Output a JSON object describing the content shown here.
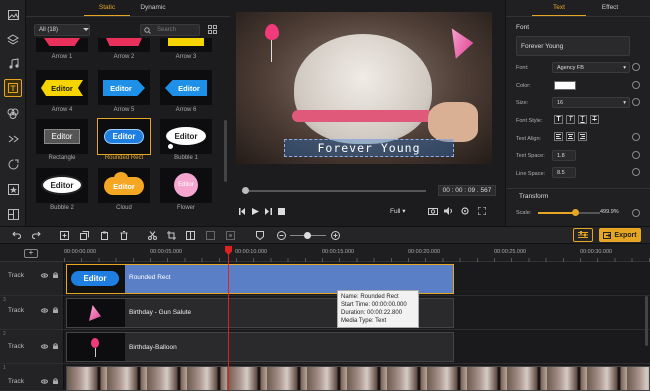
{
  "sidebar": {
    "icons": [
      "film-icon",
      "layers-icon",
      "music-icon",
      "text-icon",
      "transition-icon",
      "effect-icon",
      "sticker-icon",
      "filter-icon",
      "split-icon"
    ]
  },
  "library": {
    "tabs": [
      {
        "label": "Static",
        "active": true
      },
      {
        "label": "Dynamic",
        "active": false
      }
    ],
    "filter_value": "All (18)",
    "search_placeholder": "Search",
    "items": [
      {
        "label": "Arrow 1",
        "text": "Editor"
      },
      {
        "label": "Arrow 2",
        "text": "Editor"
      },
      {
        "label": "Arrow 3",
        "text": "Editor"
      },
      {
        "label": "Arrow 4",
        "text": "Editor"
      },
      {
        "label": "Arrow 5",
        "text": "Editor"
      },
      {
        "label": "Arrow 6",
        "text": "Editor"
      },
      {
        "label": "Rectangle",
        "text": "Editor"
      },
      {
        "label": "Rounded Rect",
        "text": "Editor"
      },
      {
        "label": "Bubble 1",
        "text": "Editor"
      },
      {
        "label": "Bubble 2",
        "text": "Editor"
      },
      {
        "label": "Cloud",
        "text": "Editor"
      },
      {
        "label": "Flower",
        "text": "Editor"
      }
    ]
  },
  "preview": {
    "overlay_text": "Forever Young",
    "timecode": "00 : 00 : 09 . 567",
    "zoom": "Full"
  },
  "properties": {
    "tabs": [
      {
        "label": "Text",
        "active": true
      },
      {
        "label": "Effect",
        "active": false
      }
    ],
    "font_section": "Font",
    "text_value": "Forever Young",
    "font_label": "Font:",
    "font_value": "Agency FB",
    "color_label": "Color:",
    "color_value": "#ffffff",
    "size_label": "Size:",
    "size_value": "16",
    "style_label": "Font Style:",
    "style_buttons": [
      "T",
      "T",
      "T",
      "T"
    ],
    "align_label": "Text Align:",
    "text_space_label": "Text Space:",
    "text_space_value": "1.8",
    "line_space_label": "Line Space:",
    "line_space_value": "8.5",
    "transform_section": "Transform",
    "scale_label": "Scale:",
    "scale_value": "499.9%",
    "scale_level": 0.6
  },
  "toolbar": {
    "export_label": "Export"
  },
  "timeline": {
    "ruler": [
      "00:00:00.000",
      "00:00:05.000",
      "00:00:10.000",
      "00:00:15.000",
      "00:00:20.000",
      "00:00:25.000",
      "00:00:30.000"
    ],
    "tracks": [
      {
        "label": "Track",
        "clip": "Rounded Rect"
      },
      {
        "label": "Track",
        "clip": "Birthday - Gun Salute"
      },
      {
        "label": "Track",
        "clip": "Birthday-Balloon"
      },
      {
        "label": "Track",
        "clip": ""
      }
    ],
    "track_numbers": [
      "3",
      "2",
      "1"
    ],
    "thumb_text": "Editor",
    "tooltip": {
      "name": "Name: Rounded Rect",
      "start": "Start Time: 00:00:00.000",
      "duration": "Duration: 00:00:22.800",
      "type": "Media Type: Text"
    }
  }
}
